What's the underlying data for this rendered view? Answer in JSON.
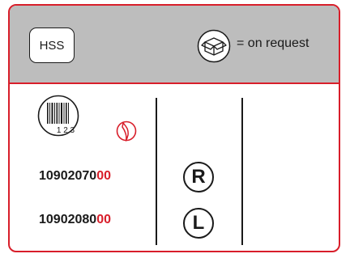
{
  "header": {
    "hss_label": "HSS",
    "packaging_note": "= on request"
  },
  "barcode_digits": "1 2 3",
  "articles": [
    {
      "number_main": "10902070",
      "number_suffix": "00",
      "direction": "R"
    },
    {
      "number_main": "10902080",
      "number_suffix": "00",
      "direction": "L"
    }
  ],
  "colors": {
    "border": "#d81e2a",
    "header_bg": "#bdbdbd",
    "accent": "#d81e2a",
    "text": "#1a1a1a"
  },
  "icons": [
    "box-icon",
    "barcode-icon",
    "drill-icon"
  ]
}
